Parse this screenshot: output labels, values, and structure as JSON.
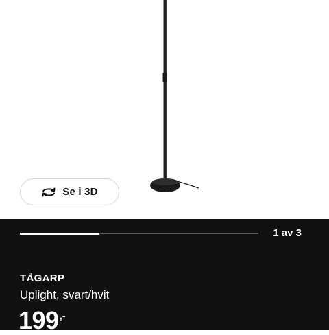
{
  "gallery": {
    "view_3d_label": "Se i 3D",
    "view_3d_icon": "rotate-3d-icon",
    "image_count_label": "1 av 3",
    "current_image": 1,
    "total_images": 3
  },
  "product": {
    "name": "TÅGARP",
    "description": "Uplight, svart/hvit",
    "price_integer": "199",
    "price_decimal": ",-"
  },
  "colors": {
    "panel_background": "#111111",
    "text_primary": "#ffffff",
    "progress_fill": "#ffffff",
    "progress_track": "#5a5a5a"
  }
}
